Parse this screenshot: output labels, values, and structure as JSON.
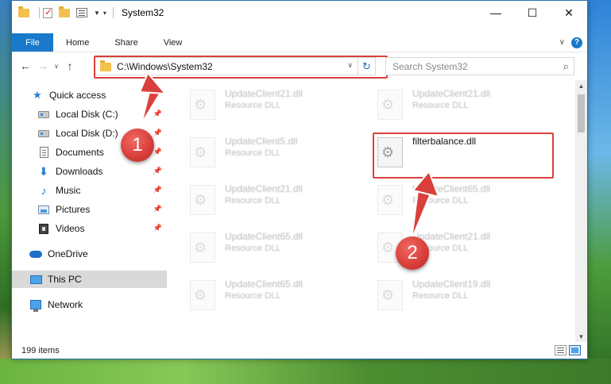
{
  "window": {
    "title": "System32"
  },
  "ribbon": {
    "tabs": [
      "File",
      "Home",
      "Share",
      "View"
    ],
    "help_glyph": "?"
  },
  "nav": {
    "address": "C:\\Windows\\System32",
    "search_placeholder": "Search System32"
  },
  "sidebar": {
    "items": [
      {
        "label": "Quick access",
        "icon": "star-icon"
      },
      {
        "label": "Local Disk (C:)",
        "icon": "drive-icon",
        "pinned": true
      },
      {
        "label": "Local Disk (D:)",
        "icon": "drive-icon",
        "pinned": true
      },
      {
        "label": "Documents",
        "icon": "document-icon",
        "pinned": true
      },
      {
        "label": "Downloads",
        "icon": "download-icon",
        "pinned": true
      },
      {
        "label": "Music",
        "icon": "music-icon",
        "pinned": true
      },
      {
        "label": "Pictures",
        "icon": "pictures-icon",
        "pinned": true
      },
      {
        "label": "Videos",
        "icon": "video-icon",
        "pinned": true
      },
      {
        "label": "OneDrive",
        "icon": "cloud-icon"
      },
      {
        "label": "This PC",
        "icon": "computer-icon",
        "selected": true
      },
      {
        "label": "Network",
        "icon": "network-icon"
      }
    ]
  },
  "files": [
    {
      "name": "UpdateClient21.dll",
      "type": "Resource DLL",
      "faded": true
    },
    {
      "name": "UpdateClient21.dll",
      "type": "Resource DLL",
      "faded": true
    },
    {
      "name": "UpdateClient5.dll",
      "type": "Resource DLL",
      "faded": true
    },
    {
      "name": "filterbalance.dll",
      "type": "",
      "faded": false
    },
    {
      "name": "UpdateClient21.dll",
      "type": "Resource DLL",
      "faded": true
    },
    {
      "name": "UpdateClient65.dll",
      "type": "Resource DLL",
      "faded": true
    },
    {
      "name": "UpdateClient65.dll",
      "type": "Resource DLL",
      "faded": true
    },
    {
      "name": "UpdateClient21.dll",
      "type": "Resource DLL",
      "faded": true
    },
    {
      "name": "UpdateClient65.dll",
      "type": "Resource DLL",
      "faded": true
    },
    {
      "name": "UpdateClient19.dll",
      "type": "Resource DLL",
      "faded": true
    }
  ],
  "status": {
    "item_count": "199 items"
  },
  "markers": [
    "1",
    "2"
  ],
  "colors": {
    "accent": "#1979ca",
    "highlight": "#d9403b"
  }
}
